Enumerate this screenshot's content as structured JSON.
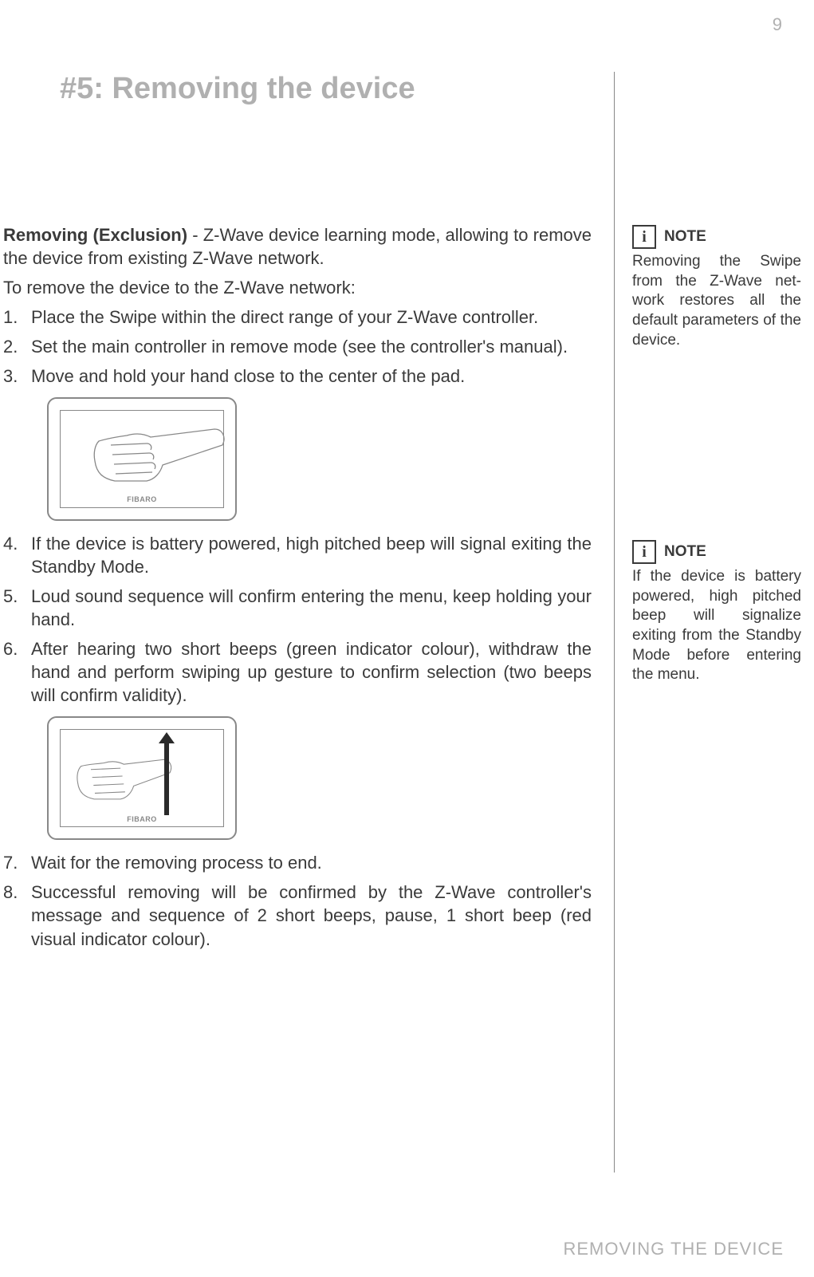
{
  "page_number": "9",
  "heading": "#5: Removing the device",
  "intro_bold": "Removing (Exclusion)",
  "intro_rest": " - Z-Wave device learning mode, allowing to remove the device from existing Z-Wave network.",
  "subheading": "To remove the device to the Z-Wave network:",
  "steps": {
    "s1": "Place the Swipe within the direct range of your Z-Wave controller.",
    "s2": "Set the main controller in remove mode (see the controller's manual).",
    "s3": "Move and hold your hand close to the center of the pad.",
    "s4": "If the device is battery powered, high pitched beep will signal exiting the Standby Mode.",
    "s5": "Loud sound sequence will confirm entering the menu, keep holding your hand.",
    "s6": "After hearing two short beeps (green indicator colour), withdraw the hand and perform swiping up gesture to confirm selection (two beeps will confirm validity).",
    "s7": "Wait for the removing process to end.",
    "s8": "Successful removing will be confirmed by the Z-Wave controller's message and sequence of 2 short beeps, pause, 1 short beep (red visual indicator colour)."
  },
  "illustration_label": "FIBARO",
  "note_icon_char": "i",
  "note_label": "NOTE",
  "notes": {
    "n1": "Removing the Swipe from the Z-Wave net­work restores all the default parameters of the device.",
    "n2": "If the device is bat­tery powered, high pitched beep will sig­nalize exiting from the Standby Mode before entering the menu."
  },
  "footer": "REMOVING THE DEVICE"
}
